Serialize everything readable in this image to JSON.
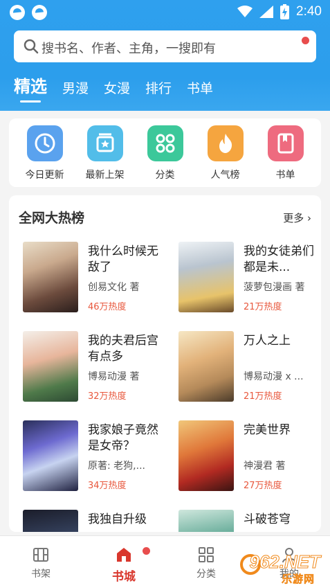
{
  "status_bar": {
    "time": "2:40"
  },
  "search": {
    "placeholder": "搜书名、作者、主角，一搜即有"
  },
  "tabs": [
    {
      "label": "精选",
      "active": true
    },
    {
      "label": "男漫",
      "active": false
    },
    {
      "label": "女漫",
      "active": false
    },
    {
      "label": "排行",
      "active": false
    },
    {
      "label": "书单",
      "active": false
    }
  ],
  "quick_menu": [
    {
      "label": "今日更新",
      "icon": "clock-icon",
      "color": "#5aa2ee"
    },
    {
      "label": "最新上架",
      "icon": "new-shelf-icon",
      "color": "#52bde9"
    },
    {
      "label": "分类",
      "icon": "category-icon",
      "color": "#3cc89a"
    },
    {
      "label": "人气榜",
      "icon": "flame-icon",
      "color": "#f5a53f"
    },
    {
      "label": "书单",
      "icon": "booklist-icon",
      "color": "#ee6b7f"
    }
  ],
  "hot_list": {
    "title": "全网大热榜",
    "more_label": "更多",
    "items": [
      {
        "title": "我什么时候无敌了",
        "author": "创易文化 著",
        "heat": "46万热度"
      },
      {
        "title": "我的女徒弟们都是未...",
        "author": "菠萝包漫画 著",
        "heat": "21万热度"
      },
      {
        "title": "我的夫君后宫有点多",
        "author": "博易动漫 著",
        "heat": "32万热度"
      },
      {
        "title": "万人之上",
        "author": "博易动漫 x ...",
        "heat": "21万热度"
      },
      {
        "title": "我家娘子竟然是女帝？",
        "author": "原著: 老狗,...",
        "heat": "34万热度"
      },
      {
        "title": "完美世界",
        "author": "神漫君 著",
        "heat": "27万热度"
      },
      {
        "title": "我独自升级",
        "author": "",
        "heat": ""
      },
      {
        "title": "斗破苍穹",
        "author": "",
        "heat": ""
      }
    ]
  },
  "bottom_nav": [
    {
      "label": "书架",
      "icon": "bookshelf-icon",
      "active": false
    },
    {
      "label": "书城",
      "icon": "home-icon",
      "active": true
    },
    {
      "label": "分类",
      "icon": "grid-icon",
      "active": false
    },
    {
      "label": "我的",
      "icon": "user-icon",
      "active": false
    }
  ],
  "watermark": {
    "number": "962.NET",
    "sub": "乐游网"
  },
  "colors": {
    "header_blue": "#2fa0ee",
    "accent_red": "#d9372d",
    "heat_orange": "#e8573c"
  }
}
